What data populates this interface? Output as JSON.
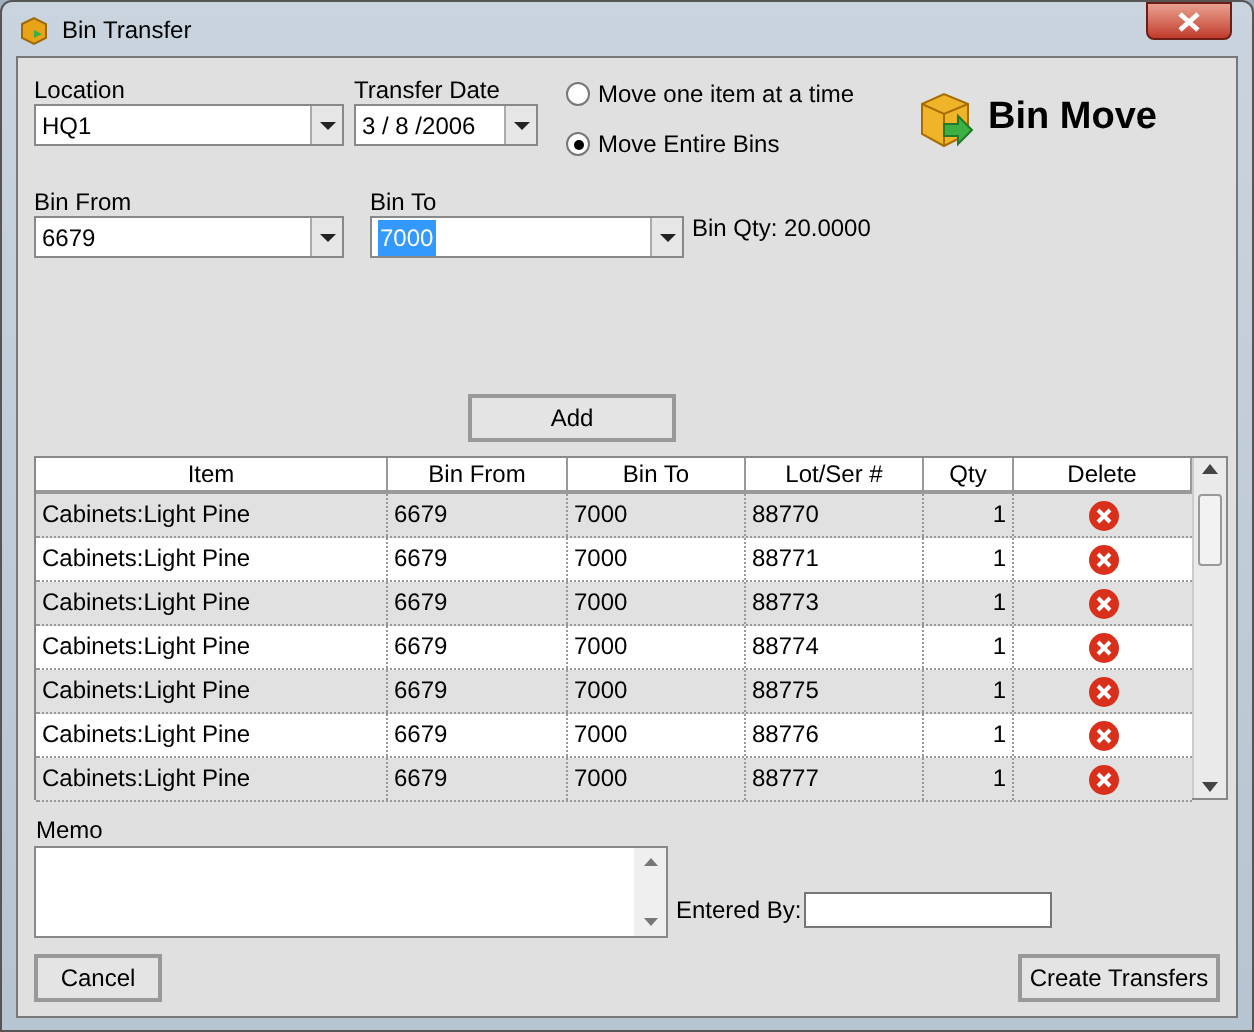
{
  "window": {
    "title": "Bin Transfer"
  },
  "location": {
    "label": "Location",
    "value": "HQ1"
  },
  "transfer_date": {
    "label": "Transfer Date",
    "value": "3 / 8 /2006"
  },
  "move_options": [
    {
      "label": "Move one item at a time",
      "selected": false
    },
    {
      "label": "Move Entire Bins",
      "selected": true
    }
  ],
  "logo": {
    "text": "Bin Move"
  },
  "bin_from": {
    "label": "Bin From",
    "value": "6679"
  },
  "bin_to": {
    "label": "Bin To",
    "value": "7000",
    "highlighted": true
  },
  "bin_qty": "Bin Qty: 20.0000",
  "add_button": "Add",
  "table": {
    "columns": [
      "Item",
      "Bin From",
      "Bin To",
      "Lot/Ser #",
      "Qty",
      "Delete"
    ],
    "rows": [
      {
        "item": "Cabinets:Light Pine",
        "bin_from": "6679",
        "bin_to": "7000",
        "lot": "88770",
        "qty": "1"
      },
      {
        "item": "Cabinets:Light Pine",
        "bin_from": "6679",
        "bin_to": "7000",
        "lot": "88771",
        "qty": "1"
      },
      {
        "item": "Cabinets:Light Pine",
        "bin_from": "6679",
        "bin_to": "7000",
        "lot": "88773",
        "qty": "1"
      },
      {
        "item": "Cabinets:Light Pine",
        "bin_from": "6679",
        "bin_to": "7000",
        "lot": "88774",
        "qty": "1"
      },
      {
        "item": "Cabinets:Light Pine",
        "bin_from": "6679",
        "bin_to": "7000",
        "lot": "88775",
        "qty": "1"
      },
      {
        "item": "Cabinets:Light Pine",
        "bin_from": "6679",
        "bin_to": "7000",
        "lot": "88776",
        "qty": "1"
      },
      {
        "item": "Cabinets:Light Pine",
        "bin_from": "6679",
        "bin_to": "7000",
        "lot": "88777",
        "qty": "1"
      }
    ]
  },
  "memo": {
    "label": "Memo"
  },
  "entered_by": {
    "label": "Entered By:"
  },
  "buttons": {
    "cancel": "Cancel",
    "create": "Create Transfers"
  }
}
